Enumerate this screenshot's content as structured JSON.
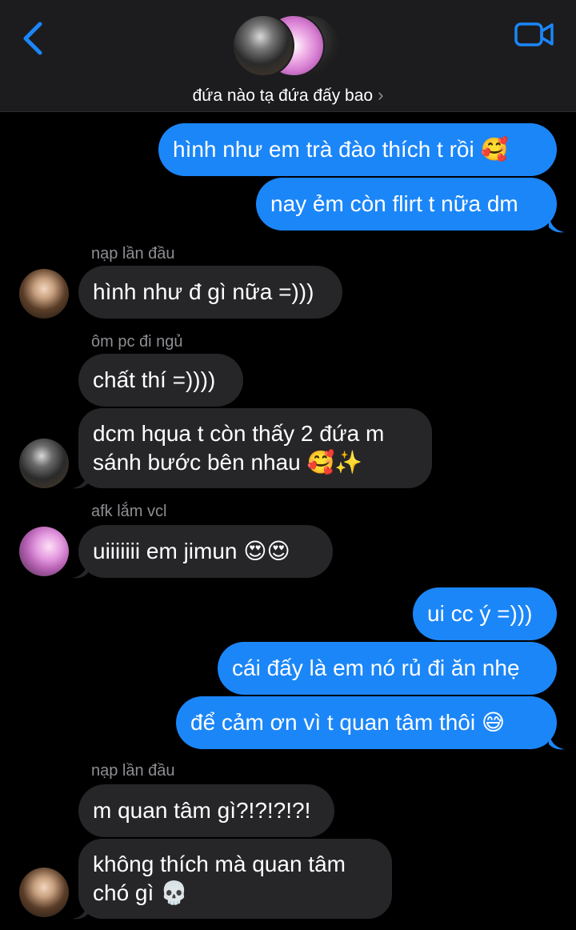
{
  "header": {
    "title": "đứa nào tạ đứa đấy bao",
    "chevron": "›",
    "back_icon": "chevron-left-icon",
    "video_icon": "video-camera-icon",
    "accent": "#1b86f8"
  },
  "messages": {
    "m1": "hình như em trà đào thích t rồi 🥰",
    "m2": "nay ẻm còn flirt t nữa dm",
    "s1": "nạp lần đầu",
    "m3": "hình như đ gì nữa =)))",
    "s2": "ôm pc đi ngủ",
    "m4": "chất thí =))))",
    "m5a": "dcm hqua t còn thấy 2 đứa m",
    "m5b": "sánh bước bên nhau 🥰✨",
    "s3": "afk lắm vcl",
    "m6": "uiiiiiii em jimun 😍😍",
    "m7": "ui cc ý =)))",
    "m8": "cái đấy là em nó rủ đi ăn nhẹ",
    "m9": "để cảm ơn vì t quan tâm thôi 😅",
    "s4": "nạp lần đầu",
    "m10": "m quan tâm gì?!?!?!?!",
    "m11a": "không thích mà quan tâm",
    "m11b": "chó gì 💀"
  },
  "colors": {
    "outgoing": "#1b86f8",
    "incoming": "#262629",
    "background": "#000000",
    "header": "#1c1c1e"
  }
}
